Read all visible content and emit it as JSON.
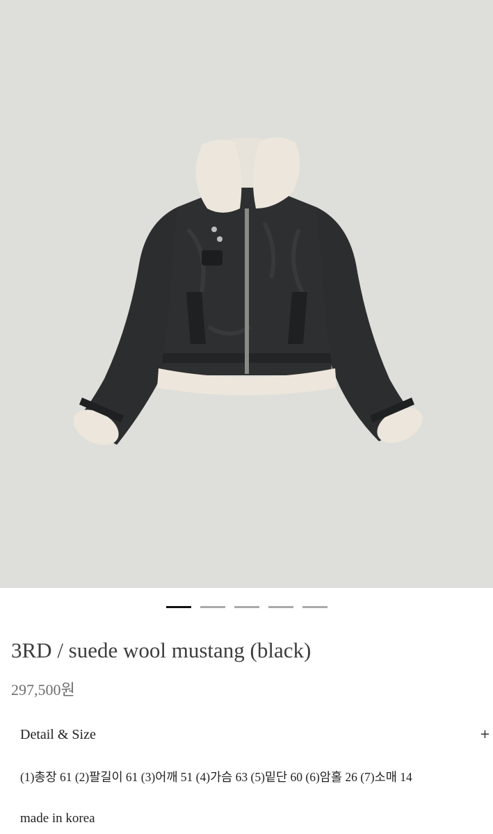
{
  "gallery": {
    "image_alt": "suede wool mustang jacket (black)",
    "slide_count": 5,
    "active_slide": 1
  },
  "product": {
    "title": "3RD / suede wool mustang (black)",
    "price": "297,500원"
  },
  "detail": {
    "label": "Detail & Size",
    "toggle_icon": "+",
    "sizes": "(1)총장 61 (2)팔길이 61 (3)어깨 51 (4)가슴 63 (5)밑단 60 (6)암홀 26 (7)소매 14",
    "origin": "made in korea"
  },
  "colors": {
    "photo_background": "#dededa",
    "jacket_suede": "#2c2d2e",
    "shearling": "#ece6dc",
    "indicator_active": "#111111",
    "indicator_inactive": "#a9a9a9"
  }
}
